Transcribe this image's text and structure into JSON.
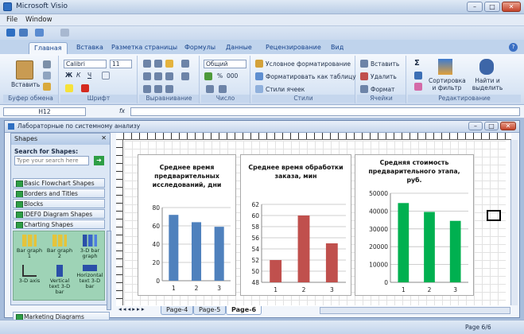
{
  "window": {
    "title": "Microsoft Visio"
  },
  "menu": [
    "File",
    "Window"
  ],
  "ribbon_tabs": [
    "Главная",
    "Вставка",
    "Разметка страницы",
    "Формулы",
    "Данные",
    "Рецензирование",
    "Вид"
  ],
  "active_tab": "Главная",
  "clipboard": {
    "paste": "Вставить",
    "label": "Буфер обмена"
  },
  "font": {
    "name": "Calibri",
    "size": "11",
    "bold": "Ж",
    "italic": "К",
    "underline": "Ч",
    "label": "Шрифт"
  },
  "align": {
    "label": "Выравнивание"
  },
  "number": {
    "format": "Общий",
    "percent": "%",
    "thousands": "000",
    "label": "Число"
  },
  "styles": {
    "cond": "Условное форматирование",
    "table": "Форматировать как таблицу",
    "cell": "Стили ячеек",
    "label": "Стили"
  },
  "cells": {
    "insert": "Вставить",
    "delete": "Удалить",
    "format": "Формат",
    "label": "Ячейки"
  },
  "editing": {
    "sum": "Σ",
    "sort": "Сортировка и фильтр",
    "find": "Найти и выделить",
    "label": "Редактирование"
  },
  "formula_bar": {
    "cell": "H12",
    "fx": "fx"
  },
  "document": {
    "title": "Лабораторные по системному анализу"
  },
  "shapes": {
    "title": "Shapes",
    "search_label": "Search for Shapes:",
    "search_placeholder": "Type your search here",
    "categories": [
      "Basic Flowchart Shapes",
      "Borders and Titles",
      "Blocks",
      "IDEF0 Diagram Shapes",
      "Charting Shapes"
    ],
    "items": [
      "Bar graph 1",
      "Bar graph 2",
      "3-D bar graph",
      "3-D axis",
      "Vertical text 3-D bar",
      "Horizontal text 3-D bar"
    ],
    "footer": "Marketing Diagrams"
  },
  "page_tabs": [
    "Page-4",
    "Page-5",
    "Page-6"
  ],
  "active_page": "Page-6",
  "status": {
    "page": "Page 6/6"
  },
  "chart_data": [
    {
      "type": "bar",
      "title": "Среднее время предварительных исследований, дни",
      "categories": [
        "1",
        "2",
        "3"
      ],
      "values": [
        72,
        64,
        59
      ],
      "ylim": [
        0,
        80
      ],
      "yticks": [
        "0",
        "20",
        "40",
        "60",
        "80"
      ],
      "color": "#4f81bd"
    },
    {
      "type": "bar",
      "title": "Среднее время обработки заказа, мин",
      "categories": [
        "1",
        "2",
        "3"
      ],
      "values": [
        52,
        60,
        55
      ],
      "ylim": [
        48,
        62
      ],
      "yticks": [
        "48",
        "50",
        "52",
        "54",
        "56",
        "58",
        "60",
        "62"
      ],
      "color": "#c0504d"
    },
    {
      "type": "bar",
      "title": "Средняя стоимость предварительного этапа, руб.",
      "categories": [
        "1",
        "2",
        "3"
      ],
      "values": [
        44500,
        39500,
        34500
      ],
      "ylim": [
        0,
        50000
      ],
      "yticks": [
        "0",
        "10000",
        "20000",
        "30000",
        "40000",
        "50000"
      ],
      "color": "#00b050"
    }
  ]
}
